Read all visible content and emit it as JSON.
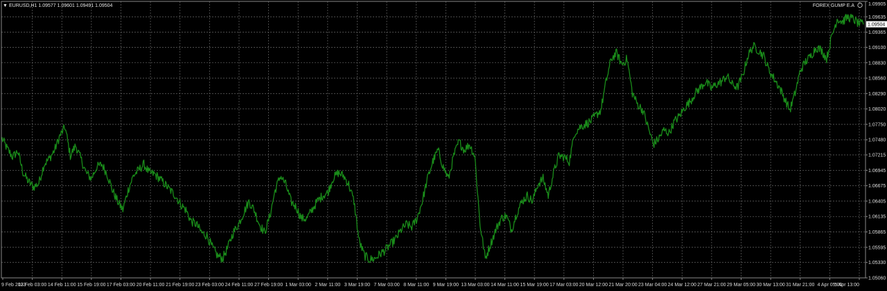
{
  "header": {
    "symbol_line": "EURUSD,H1  1.09577 1.09601 1.09491 1.09504",
    "ea_label": "FOREX GUMP E.A"
  },
  "chart_data": {
    "type": "line",
    "title": "",
    "xlabel": "",
    "ylabel": "",
    "grid": true,
    "line_color": "#1a8c1a",
    "grid_color": "#5a5a5a",
    "text_color": "#e6e6e6",
    "background": "#000000",
    "current_price": "1.09504",
    "ylim": [
      1.0506,
      1.09905
    ],
    "y_ticks": [
      "1.09905",
      "1.09635",
      "1.09365",
      "1.09100",
      "1.08830",
      "1.08560",
      "1.08290",
      "1.08020",
      "1.07750",
      "1.07480",
      "1.07215",
      "1.06945",
      "1.06675",
      "1.06405",
      "1.06135",
      "1.05865",
      "1.05595",
      "1.05330",
      "1.05060"
    ],
    "x_ticks": [
      "9 Feb 2023",
      "13 Feb 03:00",
      "14 Feb 11:00",
      "15 Feb 19:00",
      "17 Feb 03:00",
      "20 Feb 11:00",
      "21 Feb 19:00",
      "23 Feb 03:00",
      "24 Feb 11:00",
      "27 Feb 19:00",
      "1 Mar 03:00",
      "2 Mar 11:00",
      "3 Mar 19:00",
      "7 Mar 03:00",
      "8 Mar 11:00",
      "9 Mar 19:00",
      "13 Mar 03:00",
      "14 Mar 11:00",
      "15 Mar 19:00",
      "17 Mar 03:00",
      "20 Mar 12:00",
      "21 Mar 20:00",
      "23 Mar 04:00",
      "24 Mar 12:00",
      "27 Mar 21:00",
      "29 Mar 05:00",
      "30 Mar 13:00",
      "31 Mar 21:00",
      "4 Apr 05:00",
      "5 Apr 13:00"
    ],
    "series": [
      {
        "values": [
          1.075,
          1.0732,
          1.0718,
          1.0728,
          1.069,
          1.0675,
          1.0665,
          1.0672,
          1.0705,
          1.0715,
          1.073,
          1.0755,
          1.077,
          1.072,
          1.0738,
          1.0715,
          1.069,
          1.068,
          1.07,
          1.0705,
          1.0688,
          1.066,
          1.064,
          1.0625,
          1.066,
          1.0685,
          1.0695,
          1.0705,
          1.069,
          1.0688,
          1.068,
          1.067,
          1.066,
          1.065,
          1.0635,
          1.0625,
          1.0605,
          1.06,
          1.0585,
          1.058,
          1.056,
          1.0545,
          1.054,
          1.056,
          1.0585,
          1.06,
          1.062,
          1.064,
          1.0625,
          1.06,
          1.0585,
          1.0615,
          1.066,
          1.0685,
          1.067,
          1.064,
          1.063,
          1.061,
          1.061,
          1.0625,
          1.064,
          1.065,
          1.0655,
          1.068,
          1.069,
          1.0685,
          1.067,
          1.064,
          1.057,
          1.0545,
          1.0538,
          1.054,
          1.0548,
          1.0555,
          1.0565,
          1.0575,
          1.059,
          1.06,
          1.0595,
          1.061,
          1.064,
          1.068,
          1.071,
          1.073,
          1.07,
          1.068,
          1.072,
          1.0745,
          1.073,
          1.074,
          1.072,
          1.06,
          1.054,
          1.0565,
          1.059,
          1.061,
          1.0615,
          1.059,
          1.062,
          1.064,
          1.065,
          1.064,
          1.067,
          1.068,
          1.065,
          1.069,
          1.072,
          1.0718,
          1.071,
          1.076,
          1.077,
          1.0775,
          1.078,
          1.079,
          1.08,
          1.085,
          1.089,
          1.09,
          1.088,
          1.089,
          1.083,
          1.081,
          1.08,
          1.077,
          1.074,
          1.075,
          1.0765,
          1.076,
          1.078,
          1.079,
          1.0805,
          1.0815,
          1.083,
          1.084,
          1.085,
          1.0838,
          1.0845,
          1.085,
          1.086,
          1.0845,
          1.084,
          1.086,
          1.0895,
          1.0912,
          1.0905,
          1.0895,
          1.087,
          1.0855,
          1.084,
          1.082,
          1.08,
          1.083,
          1.087,
          1.0885,
          1.0895,
          1.091,
          1.0905,
          1.089,
          1.093,
          1.096,
          1.0955,
          1.0963,
          1.096,
          1.0952,
          1.095
        ]
      }
    ]
  }
}
